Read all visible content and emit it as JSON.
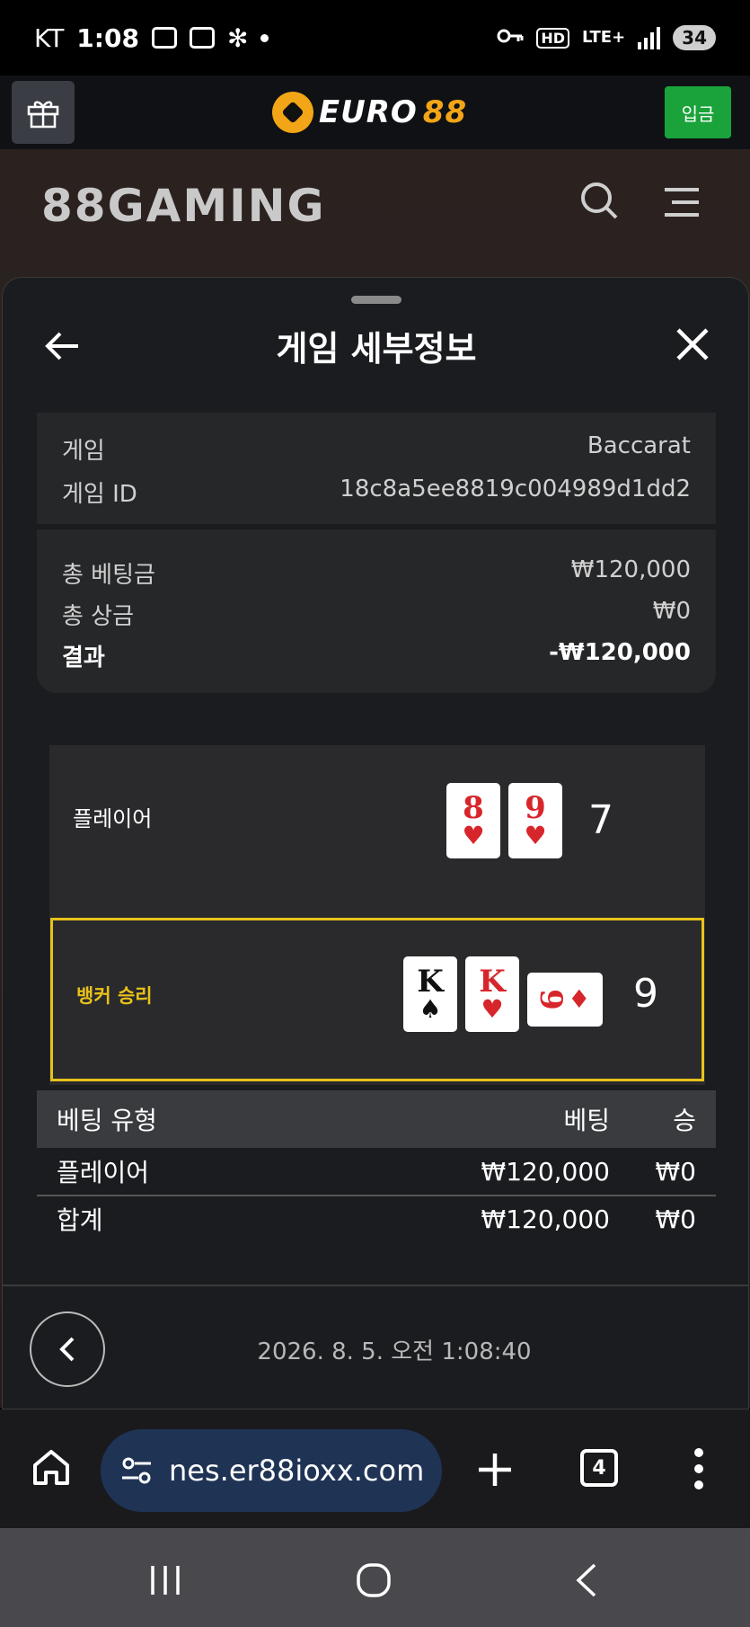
{
  "status_bar": {
    "carrier": "KT",
    "time": "1:08",
    "lte": "LTE+",
    "hd": "HD",
    "battery": "34"
  },
  "app_header": {
    "logo_main": "EURO",
    "logo_accent": "88",
    "deposit_label": "입금"
  },
  "site": {
    "gaming_logo": "88GAMING"
  },
  "sheet": {
    "title": "게임 세부정보",
    "info": {
      "game_label": "게임",
      "game_value": "Baccarat",
      "game_id_label": "게임 ID",
      "game_id_value": "18c8a5ee8819c004989d1dd2"
    },
    "totals": {
      "total_bet_label": "총 베팅금",
      "total_bet_value": "₩120,000",
      "total_prize_label": "총 상금",
      "total_prize_value": "₩0",
      "result_label": "결과",
      "result_value": "-₩120,000"
    },
    "hands": {
      "player": {
        "label": "플레이어",
        "score": "7",
        "cards": [
          {
            "rank": "8",
            "suit": "♥"
          },
          {
            "rank": "9",
            "suit": "♥"
          }
        ]
      },
      "banker": {
        "label": "뱅커 승리",
        "score": "9",
        "cards": [
          {
            "rank": "K",
            "suit": "♠"
          },
          {
            "rank": "K",
            "suit": "♥"
          },
          {
            "rank": "9",
            "suit": "♦"
          }
        ]
      }
    },
    "bet_table": {
      "headers": [
        "베팅 유형",
        "베팅",
        "승"
      ],
      "rows": [
        [
          "플레이어",
          "₩120,000",
          "₩0"
        ]
      ],
      "total": [
        "합계",
        "₩120,000",
        "₩0"
      ]
    },
    "timestamp": "2026. 8. 5. 오전 1:08:40"
  },
  "browser": {
    "url": "nes.er88ioxx.com",
    "tab_count": "4"
  },
  "colors": {
    "accent_gold": "#f2a516",
    "deposit_green": "#1aa33a",
    "winner_yellow": "#e8c21b",
    "card_red": "#d7262b",
    "url_pill": "#1f3355"
  }
}
